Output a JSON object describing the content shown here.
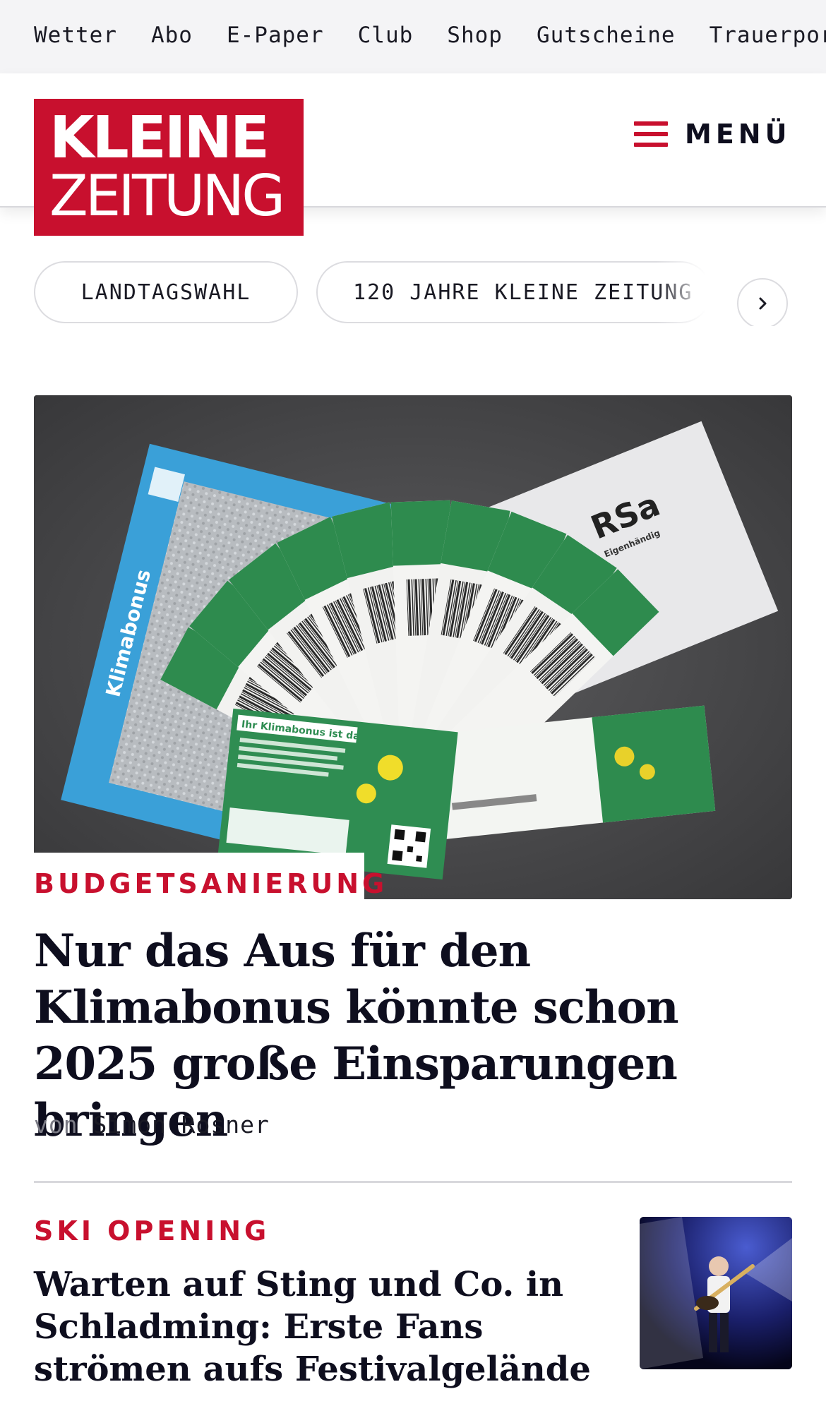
{
  "topnav": {
    "items": [
      "Wetter",
      "Abo",
      "E-Paper",
      "Club",
      "Shop",
      "Gutscheine",
      "Trauerportal"
    ]
  },
  "header": {
    "logo_line1": "KLEINE",
    "logo_line2": "ZEITUNG",
    "menu_label": "MENÜ"
  },
  "tags": {
    "items": [
      "LANDTAGSWAHL",
      "120 JAHRE KLEINE ZEITUNG"
    ]
  },
  "hero": {
    "kicker": "BUDGETSANIERUNG",
    "title": "Nur das Aus für den Klimabonus könnte schon 2025 große Einsparungen bringen",
    "byline_prefix": "von",
    "author": "Simon Rosner",
    "image_texts": {
      "envelope_label": "RSa",
      "envelope_sub": "Eigenhändig",
      "brand": "Klimabonus",
      "card_heading": "Ihr Klimabonus ist da"
    }
  },
  "article2": {
    "kicker": "SKI OPENING",
    "title": "Warten auf Sting und Co. in Schladming: Erste Fans strömen aufs Festivalgelände"
  },
  "colors": {
    "brand_red": "#c8102e",
    "text_dark": "#0e0e1e",
    "topbar_bg": "#f4f4f6",
    "border": "#dcdce0"
  }
}
